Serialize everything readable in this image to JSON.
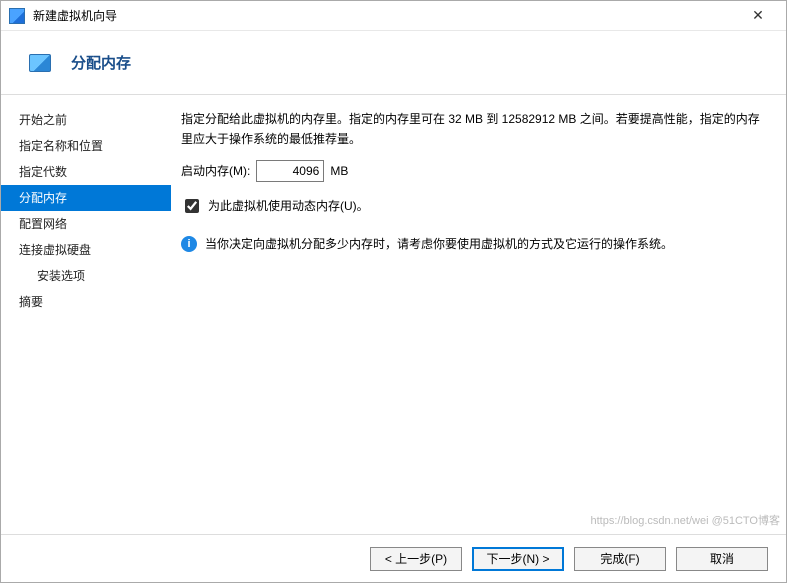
{
  "window": {
    "title": "新建虚拟机向导"
  },
  "header": {
    "title": "分配内存"
  },
  "sidebar": {
    "items": [
      {
        "label": "开始之前"
      },
      {
        "label": "指定名称和位置"
      },
      {
        "label": "指定代数"
      },
      {
        "label": "分配内存"
      },
      {
        "label": "配置网络"
      },
      {
        "label": "连接虚拟硬盘"
      },
      {
        "label": "安装选项"
      },
      {
        "label": "摘要"
      }
    ],
    "selected_index": 3
  },
  "content": {
    "desc": "指定分配给此虚拟机的内存里。指定的内存里可在 32 MB 到 12582912 MB 之间。若要提高性能，指定的内存里应大于操作系统的最低推荐量。",
    "memory_label": "启动内存(M):",
    "memory_value": "4096",
    "memory_unit": "MB",
    "dynamic_label": "为此虚拟机使用动态内存(U)。",
    "dynamic_checked": true,
    "info_text": "当你决定向虚拟机分配多少内存时，请考虑你要使用虚拟机的方式及它运行的操作系统。"
  },
  "footer": {
    "prev": "< 上一步(P)",
    "next": "下一步(N) >",
    "finish": "完成(F)",
    "cancel": "取消"
  },
  "watermark": "https://blog.csdn.net/wei @51CTO博客"
}
